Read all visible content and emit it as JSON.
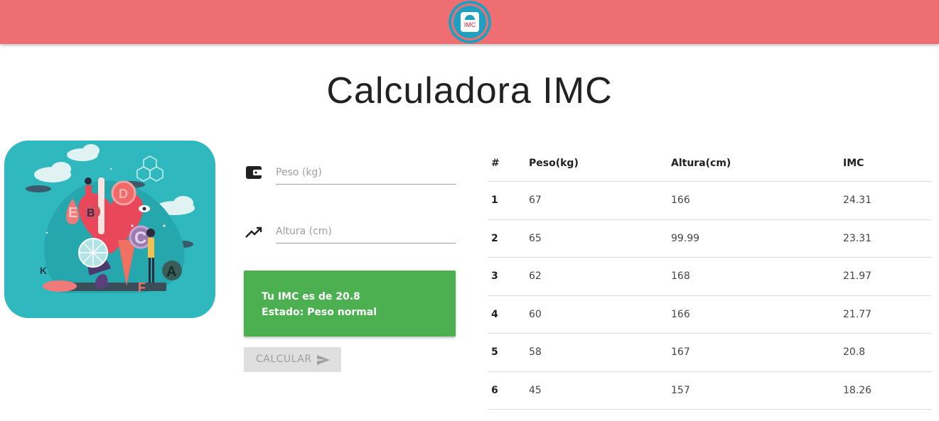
{
  "header": {
    "logo_text": "IMC",
    "bar_color": "#ef6e72",
    "logo_color": "#1ea0bf"
  },
  "page_title": "Calculadora IMC",
  "form": {
    "weight": {
      "placeholder": "Peso (kg)",
      "value": "",
      "icon": "wallet-icon"
    },
    "height": {
      "placeholder": "Altura (cm)",
      "value": "",
      "icon": "trending-up-icon"
    },
    "result": {
      "line1": "Tu IMC es de 20.8",
      "line2": "Estado: Peso normal",
      "color": "#4caf50"
    },
    "calculate_label": "CALCULAR",
    "calculate_icon": "send-icon"
  },
  "table": {
    "headers": [
      "#",
      "Peso(kg)",
      "Altura(cm)",
      "IMC"
    ],
    "rows": [
      [
        "1",
        "67",
        "166",
        "24.31"
      ],
      [
        "2",
        "65",
        "99.99",
        "23.31"
      ],
      [
        "3",
        "62",
        "168",
        "21.97"
      ],
      [
        "4",
        "60",
        "166",
        "21.77"
      ],
      [
        "5",
        "58",
        "167",
        "20.8"
      ],
      [
        "6",
        "45",
        "157",
        "18.26"
      ]
    ]
  },
  "illustration": {
    "letters": [
      "E",
      "B",
      "D",
      "C",
      "K",
      "A",
      "F"
    ]
  }
}
